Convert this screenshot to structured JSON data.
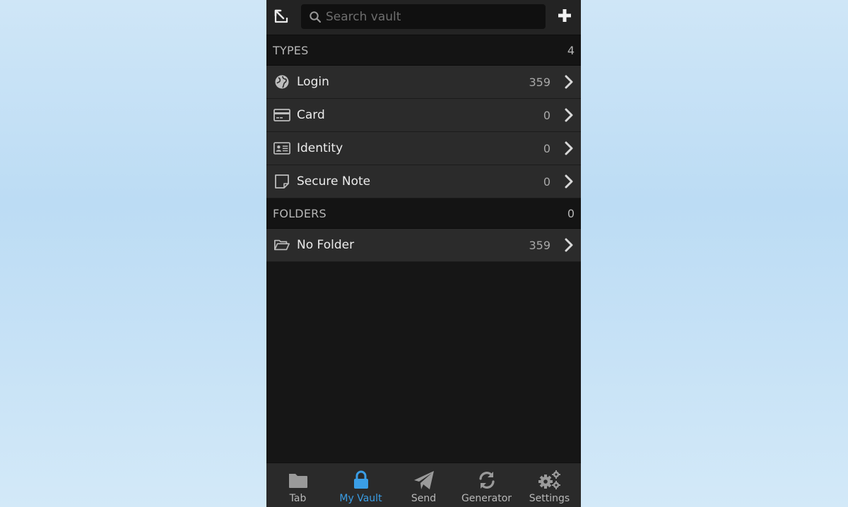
{
  "header": {
    "search_placeholder": "Search vault",
    "popout_icon": "popout-icon",
    "add_icon": "plus-icon"
  },
  "types": {
    "title": "TYPES",
    "count": "4",
    "items": [
      {
        "label": "Login",
        "count": "359",
        "icon": "globe-icon"
      },
      {
        "label": "Card",
        "count": "0",
        "icon": "credit-card-icon"
      },
      {
        "label": "Identity",
        "count": "0",
        "icon": "id-card-icon"
      },
      {
        "label": "Secure Note",
        "count": "0",
        "icon": "sticky-note-icon"
      }
    ]
  },
  "folders": {
    "title": "FOLDERS",
    "count": "0",
    "items": [
      {
        "label": "No Folder",
        "count": "359",
        "icon": "folder-open-icon"
      }
    ]
  },
  "tabs": [
    {
      "label": "Tab",
      "icon": "folder-icon",
      "active": false
    },
    {
      "label": "My Vault",
      "icon": "lock-icon",
      "active": true
    },
    {
      "label": "Send",
      "icon": "paper-plane-icon",
      "active": false
    },
    {
      "label": "Generator",
      "icon": "refresh-icon",
      "active": false
    },
    {
      "label": "Settings",
      "icon": "cogs-icon",
      "active": false
    }
  ],
  "colors": {
    "accent": "#3a9ee6",
    "panel_bg": "#161616",
    "row_bg": "#2b2b2b"
  }
}
